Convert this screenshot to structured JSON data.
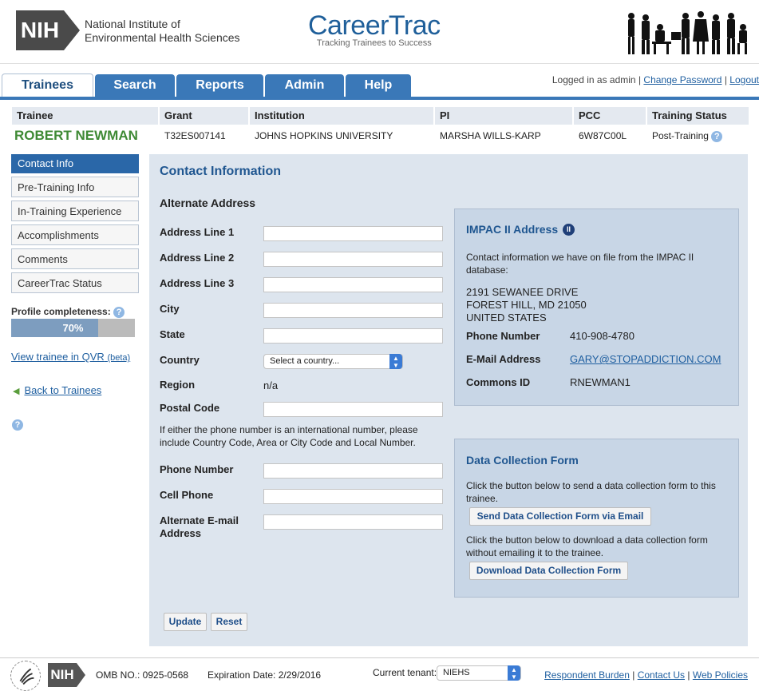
{
  "header": {
    "nih_logo_text": "NIH",
    "institute_line1": "National Institute of",
    "institute_line2": "Environmental Health Sciences",
    "brand_title": "CareerTrac",
    "brand_tagline": "Tracking Trainees to Success"
  },
  "tabs": [
    {
      "label": "Trainees",
      "active": true
    },
    {
      "label": "Search",
      "active": false
    },
    {
      "label": "Reports",
      "active": false
    },
    {
      "label": "Admin",
      "active": false
    },
    {
      "label": "Help",
      "active": false
    }
  ],
  "session": {
    "logged_in_text": "Logged in as admin",
    "change_password": "Change Password",
    "logout": "Logout"
  },
  "trainee": {
    "headers": [
      "Trainee",
      "Grant",
      "Institution",
      "PI",
      "PCC",
      "Training Status"
    ],
    "name": "ROBERT NEWMAN",
    "grant": "T32ES007141",
    "institution": "JOHNS HOPKINS UNIVERSITY",
    "pi": "MARSHA WILLS-KARP",
    "pcc": "6W87C00L",
    "status": "Post-Training"
  },
  "sidebar": {
    "items": [
      {
        "label": "Contact Info",
        "active": true
      },
      {
        "label": "Pre-Training Info",
        "active": false
      },
      {
        "label": "In-Training Experience",
        "active": false
      },
      {
        "label": "Accomplishments",
        "active": false
      },
      {
        "label": "Comments",
        "active": false
      },
      {
        "label": "CareerTrac Status",
        "active": false
      }
    ],
    "profile_label": "Profile completeness:",
    "profile_percent": 70,
    "profile_percent_text": "70%",
    "qvr_link": "View trainee in QVR",
    "qvr_beta": "(beta)",
    "back_link": "Back to Trainees",
    "help_glyph": "?"
  },
  "contact": {
    "title": "Contact Information",
    "alt_address_title": "Alternate Address",
    "fields": {
      "address1": {
        "label": "Address Line 1",
        "value": ""
      },
      "address2": {
        "label": "Address Line 2",
        "value": ""
      },
      "address3": {
        "label": "Address Line 3",
        "value": ""
      },
      "city": {
        "label": "City",
        "value": ""
      },
      "state": {
        "label": "State",
        "value": ""
      },
      "country": {
        "label": "Country",
        "selected": "Select a country..."
      },
      "region": {
        "label": "Region",
        "value": "n/a"
      },
      "postal": {
        "label": "Postal Code",
        "value": ""
      },
      "phone": {
        "label": "Phone Number",
        "value": ""
      },
      "cell": {
        "label": "Cell Phone",
        "value": ""
      },
      "email_line1": "Alternate E-mail",
      "email_line2": "Address"
    },
    "intl_note": "If either the phone number is an international number, please include Country Code, Area or City Code and Local Number.",
    "update_button": "Update",
    "reset_button": "Reset"
  },
  "impac": {
    "title": "IMPAC II Address",
    "badge": "II",
    "intro": "Contact information we have on file from the IMPAC II database:",
    "address_line1": "2191 SEWANEE DRIVE",
    "address_line2": "FOREST HILL, MD 21050",
    "address_line3": "UNITED STATES",
    "phone_label": "Phone Number",
    "phone_value": "410-908-4780",
    "email_label": "E-Mail Address",
    "email_value": "GARY@STOPADDICTION.COM",
    "commons_label": "Commons ID",
    "commons_value": "RNEWMAN1"
  },
  "dcf": {
    "title": "Data Collection Form",
    "send_text": "Click the button below to send a data collection form to this trainee.",
    "send_button": "Send Data Collection Form via Email",
    "download_text": "Click the button below to download a data collection form without emailing it to the trainee.",
    "download_button": "Download Data Collection Form"
  },
  "footer": {
    "nih_text": "NIH",
    "omb": "OMB NO.: 0925-0568",
    "expiration": "Expiration Date: 2/29/2016",
    "tenant_label": "Current tenant:",
    "tenant_value": "NIEHS",
    "link_burden": "Respondent Burden",
    "link_contact": "Contact Us",
    "link_policies": "Web Policies"
  },
  "colors": {
    "primary_blue": "#3a78b8",
    "trainee_green": "#3f8a35",
    "panel_bg": "#dde5ee",
    "box_bg": "#c8d6e6"
  }
}
